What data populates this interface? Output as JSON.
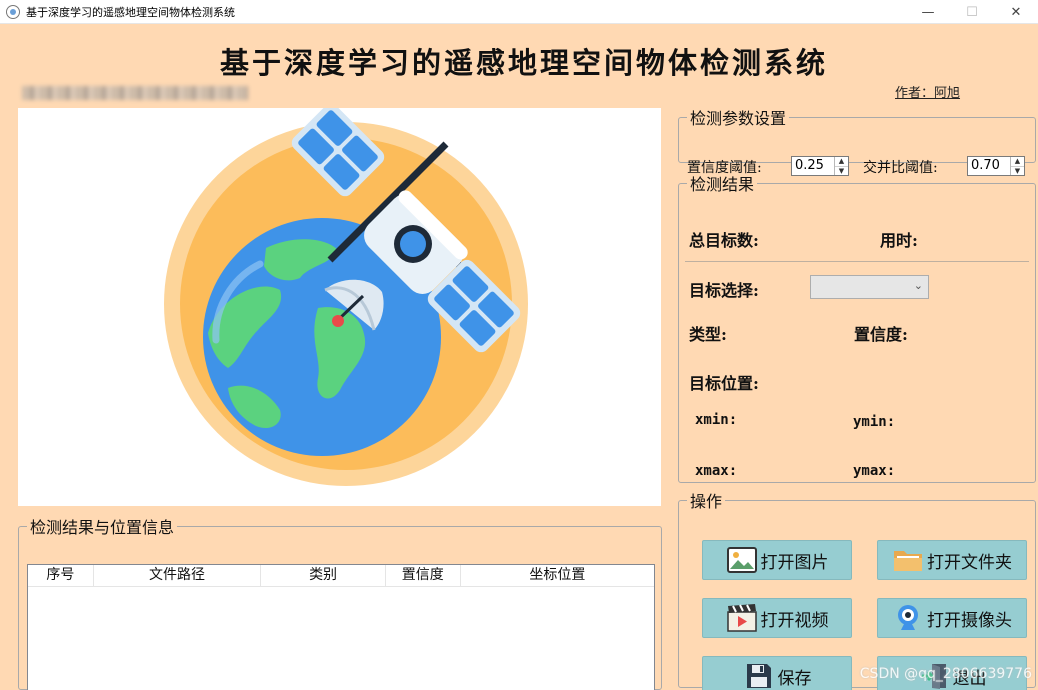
{
  "window": {
    "title": "基于深度学习的遥感地理空间物体检测系统",
    "minimize": "—",
    "maximize": "☐",
    "close": "✕"
  },
  "header": {
    "title": "基于深度学习的遥感地理空间物体检测系统",
    "author": "作者：阿旭"
  },
  "params": {
    "legend": "检测参数设置",
    "conf_label": "置信度阈值:",
    "conf_value": "0.25",
    "iou_label": "交并比阈值:",
    "iou_value": "0.70"
  },
  "results": {
    "legend": "检测结果",
    "total_label": "总目标数:",
    "time_label": "用时:",
    "select_label": "目标选择:",
    "select_value": "",
    "type_label": "类型:",
    "conf_label": "置信度:",
    "position_label": "目标位置:",
    "xmin": "xmin:",
    "ymin": "ymin:",
    "xmax": "xmax:",
    "ymax": "ymax:"
  },
  "operations": {
    "legend": "操作",
    "open_image": "打开图片",
    "open_folder": "打开文件夹",
    "open_video": "打开视频",
    "open_camera": "打开摄像头",
    "save": "保存",
    "exit": "退出"
  },
  "table": {
    "legend": "检测结果与位置信息",
    "columns": [
      "序号",
      "文件路径",
      "类别",
      "置信度",
      "坐标位置"
    ]
  },
  "watermark": "CSDN @qq_2806639776",
  "icons": [
    "app-icon",
    "earth-satellite-illustration",
    "picture-icon",
    "folder-icon",
    "video-icon",
    "webcam-icon",
    "floppy-save-icon",
    "exit-door-icon",
    "chevron-down-icon"
  ]
}
